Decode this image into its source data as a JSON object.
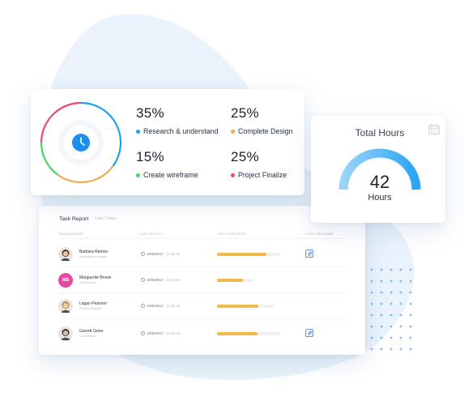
{
  "colors": {
    "blue": "#1da1f2",
    "orange": "#f5a94c",
    "green": "#4bd369",
    "red": "#ee4a6c",
    "bar": "#f2b94a",
    "gauge": "#5cb8f5"
  },
  "stats": {
    "center_icon": "clock-icon",
    "items": [
      {
        "percent": "35%",
        "label": "Research & understand",
        "value": 35,
        "color": "#1da1f2"
      },
      {
        "percent": "25%",
        "label": "Complete Design",
        "value": 25,
        "color": "#f5a94c"
      },
      {
        "percent": "15%",
        "label": "Create wireframe",
        "value": 15,
        "color": "#4bd369"
      },
      {
        "percent": "25%",
        "label": "Project Finalize",
        "value": 25,
        "color": "#ee4a6c"
      }
    ]
  },
  "hours": {
    "title": "Total Hours",
    "value": "42",
    "unit": "Hours",
    "icon": "calendar-icon"
  },
  "task_report": {
    "title": "Task Report",
    "subtitle": "Last 7 days",
    "columns": [
      "TEAM MEMBER",
      "LAST ACTIVITY",
      "TASK COMPLETED",
      "FILES UPLOADED"
    ],
    "rows": [
      {
        "name": "Barbara Ramos",
        "role": "Acquisition manager",
        "date": "19/06/2017",
        "time": "11:35 AM",
        "progress": 0.76,
        "avatar": "photo",
        "initials": "",
        "has_file": true
      },
      {
        "name": "Marguerite Brown",
        "role": "Web Analyst",
        "date": "19/06/2017",
        "time": "11:35 AM",
        "progress": 0.4,
        "avatar": "initials",
        "initials": "MB",
        "has_file": false
      },
      {
        "name": "Logan Pearson",
        "role": "Project Manager",
        "date": "19/06/2017",
        "time": "11:35 AM",
        "progress": 0.64,
        "avatar": "photo",
        "initials": "",
        "has_file": false
      },
      {
        "name": "Garrett Greer",
        "role": "UX Designer",
        "date": "19/06/2017",
        "time": "11:35 AM",
        "progress": 0.62,
        "avatar": "photo",
        "initials": "",
        "has_file": true
      }
    ]
  }
}
